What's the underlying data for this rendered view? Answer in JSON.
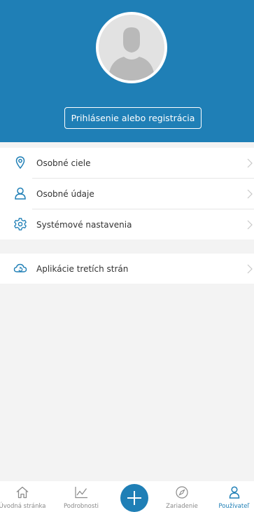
{
  "header": {
    "login_button": "Prihlásenie alebo registrácia"
  },
  "menu": {
    "personal_goals": "Osobné ciele",
    "personal_data": "Osobné údaje",
    "system_settings": "Systémové nastavenia",
    "third_party_apps": "Aplikácie tretích strán"
  },
  "tabs": {
    "home": "Úvodná stránka",
    "details": "Podrobnosti",
    "device": "Zariadenie",
    "user": "Používateľ"
  },
  "colors": {
    "accent": "#1f7fb6"
  }
}
